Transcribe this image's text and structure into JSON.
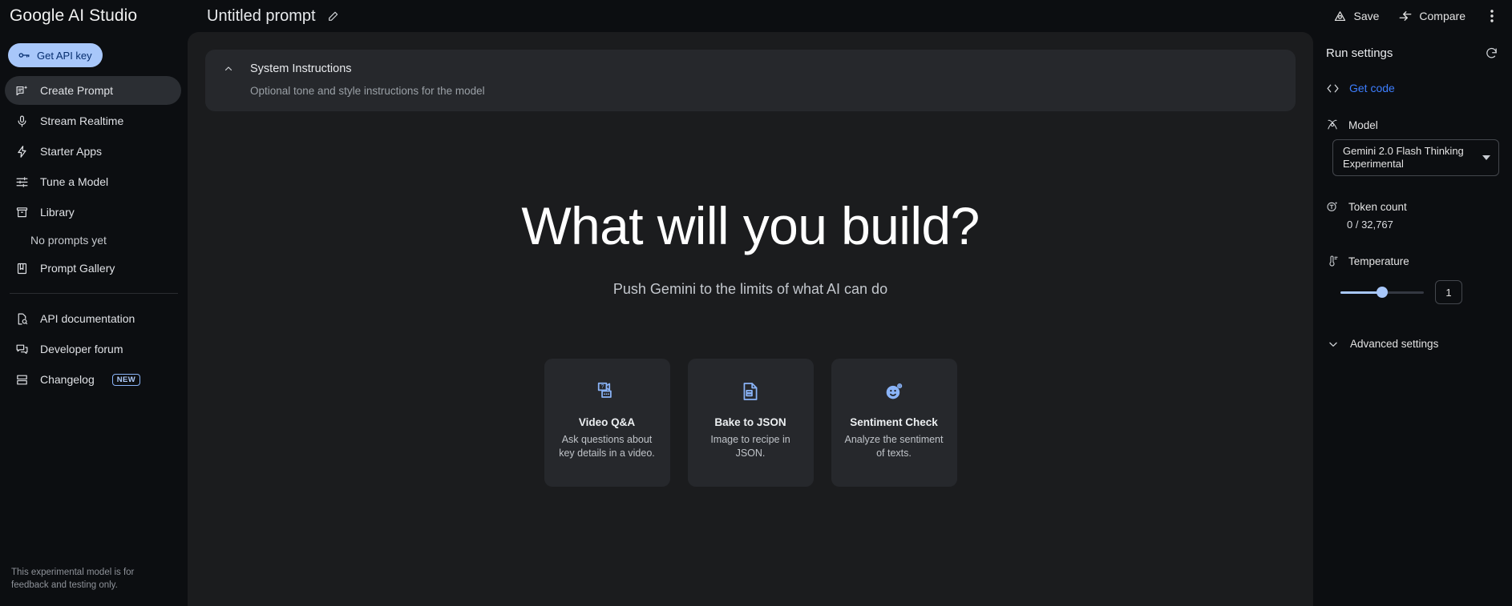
{
  "app": {
    "brand": "Google AI Studio"
  },
  "topbar": {
    "prompt_title": "Untitled prompt",
    "edit_icon": "pencil-icon",
    "save_label": "Save",
    "compare_label": "Compare",
    "more_icon": "kebab-menu-icon"
  },
  "sidebar": {
    "api_key_label": "Get API key",
    "api_key_icon": "key-icon",
    "items": [
      {
        "label": "Create Prompt",
        "icon": "create-prompt-icon",
        "active": true
      },
      {
        "label": "Stream Realtime",
        "icon": "microphone-icon",
        "active": false
      },
      {
        "label": "Starter Apps",
        "icon": "bolt-icon",
        "active": false
      },
      {
        "label": "Tune a Model",
        "icon": "tune-sliders-icon",
        "active": false
      },
      {
        "label": "Library",
        "icon": "archive-icon",
        "active": false
      }
    ],
    "empty_library_note": "No prompts yet",
    "gallery": {
      "label": "Prompt Gallery",
      "icon": "book-icon"
    },
    "footer_links": [
      {
        "label": "API documentation",
        "icon": "document-search-icon",
        "badge": ""
      },
      {
        "label": "Developer forum",
        "icon": "forum-icon",
        "badge": ""
      },
      {
        "label": "Changelog",
        "icon": "list-icon",
        "badge": "NEW"
      }
    ],
    "disclaimer": "This experimental model is for feedback and testing only."
  },
  "main": {
    "system_instructions": {
      "title": "System Instructions",
      "subtitle": "Optional tone and style instructions for the model",
      "collapse_icon": "chevron-up-icon"
    },
    "hero_title": "What will you build?",
    "hero_subtitle": "Push Gemini to the limits of what AI can do",
    "cards": [
      {
        "title": "Video Q&A",
        "desc": "Ask questions about key details in a video.",
        "icon": "video-question-icon"
      },
      {
        "title": "Bake to JSON",
        "desc": "Image to recipe in JSON.",
        "icon": "document-json-icon"
      },
      {
        "title": "Sentiment Check",
        "desc": "Analyze the sentiment of texts.",
        "icon": "smiley-plus-icon"
      }
    ]
  },
  "run_settings": {
    "title": "Run settings",
    "reset_icon": "reset-icon",
    "get_code": {
      "label": "Get code",
      "icon": "code-brackets-icon"
    },
    "model": {
      "label": "Model",
      "icon": "model-atom-icon",
      "selected": "Gemini 2.0 Flash Thinking Experimental",
      "caret_icon": "caret-down-icon"
    },
    "token_count": {
      "label": "Token count",
      "icon": "token-icon",
      "value": "0 / 32,767"
    },
    "temperature": {
      "label": "Temperature",
      "icon": "thermometer-icon",
      "value": "1",
      "percent": 50
    },
    "advanced": {
      "label": "Advanced settings",
      "icon": "chevron-down-icon"
    }
  },
  "colors": {
    "accent_blue": "#a8c7fa",
    "link_blue": "#3d7eff",
    "sidebar_bg": "#0c0e11",
    "main_bg": "#1b1c1e",
    "card_bg": "#26282c"
  }
}
